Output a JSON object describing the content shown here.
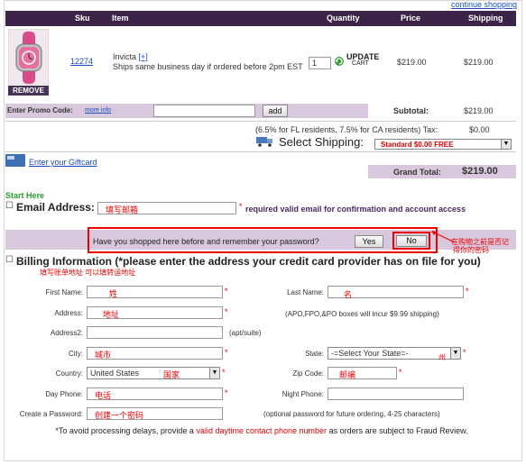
{
  "links": {
    "continue_shopping": "continue shopping",
    "more_info": "more info",
    "giftcard": "Enter your Giftcard"
  },
  "cart": {
    "headers": {
      "sku": "Sku",
      "item": "Item",
      "quantity": "Quantity",
      "price": "Price",
      "shipping": "Shipping"
    },
    "item": {
      "sku": "12274",
      "name": "Invicta",
      "plus": "[+]",
      "ships": "Ships same business day if ordered before 2pm EST",
      "qty": "1",
      "update_top": "UPDATE",
      "update_bottom": "CART",
      "price": "$219.00",
      "shipping": "$219.00",
      "remove": "REMOVE"
    },
    "promo_label": "Enter Promo Code:",
    "add_label": "add",
    "subtotal_label": "Subtotal:",
    "subtotal_value": "$219.00",
    "tax_text": "(6.5% for FL residents, 7.5% for CA residents) Tax:",
    "tax_value": "$0.00",
    "select_shipping_label": "Select Shipping:",
    "shipping_option": "Standard  $0.00  FREE",
    "grand_total_label": "Grand Total:",
    "grand_total_value": "$219.00"
  },
  "form": {
    "start_here": "Start Here",
    "email_heading": "Email Address:",
    "email_note": "required valid email for confirmation and account access",
    "returning_question": "Have you shopped here before and remember your password?",
    "yes": "Yes",
    "no": "No",
    "billing_heading": "Billing Information (*please enter the address your credit card provider has on file for you)",
    "labels": {
      "first_name": "First Name:",
      "last_name": "Last Name:",
      "address": "Address:",
      "address2": "Address2:",
      "city": "City:",
      "state": "State:",
      "country": "Country:",
      "zip": "Zip Code:",
      "day_phone": "Day Phone:",
      "night_phone": "Night Phone:",
      "password": "Create a Password:"
    },
    "apo_note": "(APO,FPO,&PO boxes will incur $9.99 shipping)",
    "apt_note": "(apt/suite)",
    "state_select": "-=Select Your State=-",
    "country_select": "United States",
    "password_note": "(optional password for future ordering, 4-25 characters)",
    "footer_prefix": "*To avoid processing delays, provide a",
    "footer_red": "valid daytime contact phone number",
    "footer_suffix": "as orders are subject to Fraud Review."
  },
  "annotations": {
    "email": "填写邮箱",
    "billing": "填写账单地址 可以填转运地址",
    "first": "姓",
    "last": "名",
    "address": "地址",
    "city": "城市",
    "state": "州",
    "country": "国家",
    "zip": "邮编",
    "phone": "电话",
    "password": "创建一个密码",
    "returning_line1": "在购物之前是否记",
    "returning_line2": "得你的密码"
  }
}
